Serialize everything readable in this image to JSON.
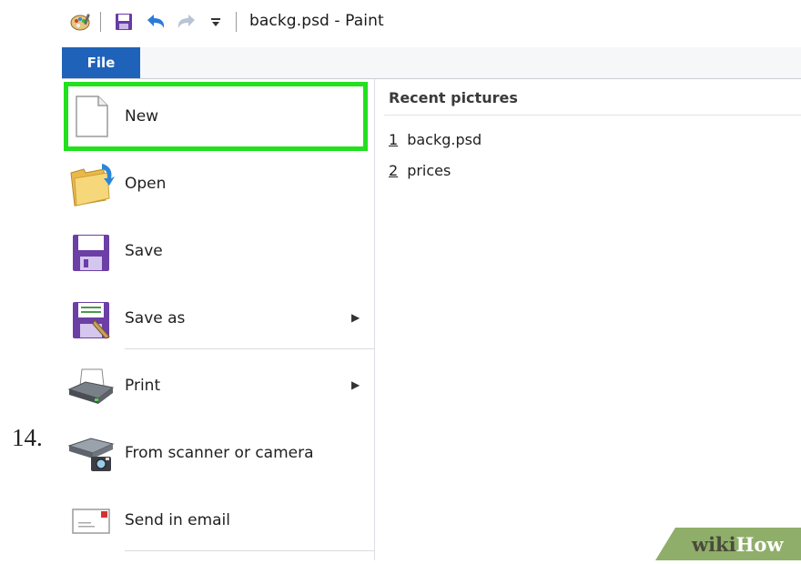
{
  "step_number": "14.",
  "window": {
    "title": "backg.psd - Paint",
    "quick_access": [
      "paint-app-icon",
      "save-icon",
      "undo-icon",
      "redo-icon",
      "customize-dropdown-icon"
    ]
  },
  "ribbon": {
    "file_tab": "File"
  },
  "file_menu": {
    "items": [
      {
        "label": "New",
        "icon": "new-document-icon",
        "has_submenu": false
      },
      {
        "label": "Open",
        "icon": "open-folder-icon",
        "has_submenu": false
      },
      {
        "label": "Save",
        "icon": "save-icon",
        "has_submenu": false
      },
      {
        "label": "Save as",
        "icon": "save-as-icon",
        "has_submenu": true
      },
      {
        "label": "Print",
        "icon": "printer-icon",
        "has_submenu": true
      },
      {
        "label": "From scanner or camera",
        "icon": "scanner-icon",
        "has_submenu": false
      },
      {
        "label": "Send in email",
        "icon": "email-icon",
        "has_submenu": false
      }
    ],
    "highlighted": "New",
    "highlight_color": "#22e01e"
  },
  "recent_pictures": {
    "header": "Recent pictures",
    "items": [
      {
        "num": "1",
        "name": "backg.psd"
      },
      {
        "num": "2",
        "name": "prices"
      }
    ]
  },
  "watermark": {
    "text_wiki": "wiki",
    "text_how": "How"
  },
  "colors": {
    "file_tab": "#1e63b9",
    "highlight": "#22e01e"
  }
}
